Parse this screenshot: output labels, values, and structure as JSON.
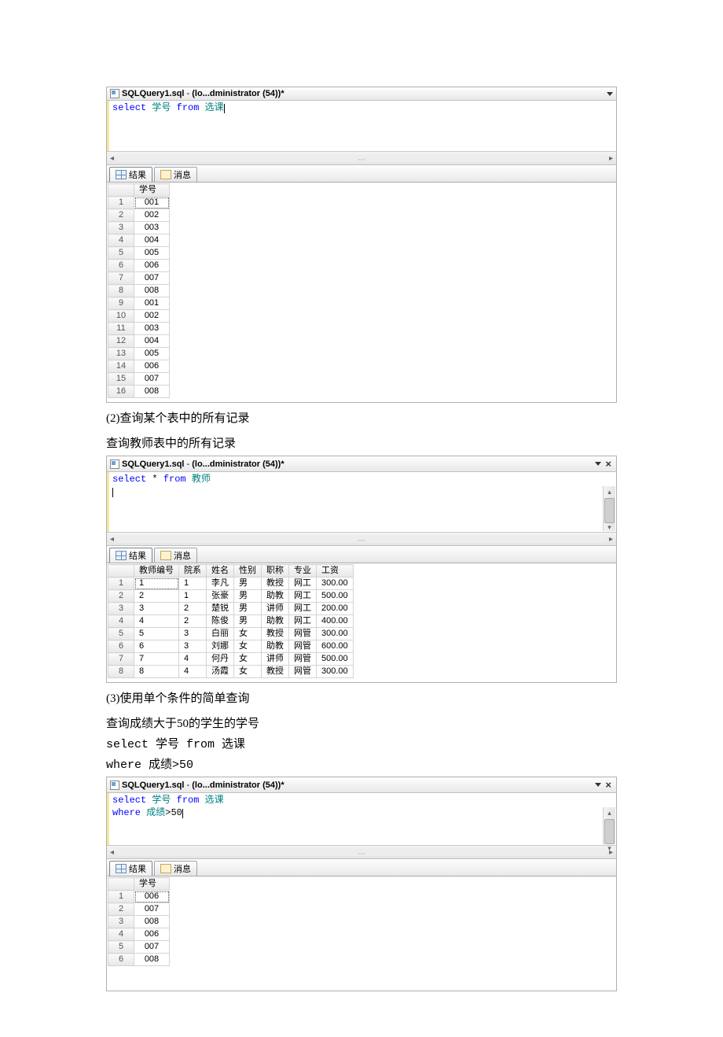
{
  "panel1": {
    "title_prefix": "SQLQuery1.sql",
    "title_sep": " - ",
    "title_suffix": "(lo...dministrator (54))*",
    "sql_tokens": [
      "select",
      " ",
      "学号",
      " ",
      "from",
      " ",
      "选课"
    ],
    "tabs": {
      "results": "结果",
      "messages": "消息"
    },
    "columns": [
      "学号"
    ],
    "rows": [
      [
        "001"
      ],
      [
        "002"
      ],
      [
        "003"
      ],
      [
        "004"
      ],
      [
        "005"
      ],
      [
        "006"
      ],
      [
        "007"
      ],
      [
        "008"
      ],
      [
        "001"
      ],
      [
        "002"
      ],
      [
        "003"
      ],
      [
        "004"
      ],
      [
        "005"
      ],
      [
        "006"
      ],
      [
        "007"
      ],
      [
        "008"
      ]
    ]
  },
  "text1": "(2)查询某个表中的所有记录",
  "text2": "查询教师表中的所有记录",
  "panel2": {
    "title_prefix": "SQLQuery1.sql",
    "title_sep": " - ",
    "title_suffix": "(lo...dministrator (54))*",
    "sql_tokens": [
      "select",
      " ",
      "*",
      " ",
      "from",
      " ",
      "教师"
    ],
    "tabs": {
      "results": "结果",
      "messages": "消息"
    },
    "columns": [
      "教师编号",
      "院系",
      "姓名",
      "性别",
      "职称",
      "专业",
      "工资"
    ],
    "rows": [
      [
        "1",
        "1",
        "李凡",
        "男",
        "教授",
        "网工",
        "300.00"
      ],
      [
        "2",
        "1",
        "张豪",
        "男",
        "助教",
        "网工",
        "500.00"
      ],
      [
        "3",
        "2",
        "楚锐",
        "男",
        "讲师",
        "网工",
        "200.00"
      ],
      [
        "4",
        "2",
        "陈俊",
        "男",
        "助教",
        "网工",
        "400.00"
      ],
      [
        "5",
        "3",
        "白丽",
        "女",
        "教授",
        "网管",
        "300.00"
      ],
      [
        "6",
        "3",
        "刘娜",
        "女",
        "助教",
        "网管",
        "600.00"
      ],
      [
        "7",
        "4",
        "何丹",
        "女",
        "讲师",
        "网管",
        "500.00"
      ],
      [
        "8",
        "4",
        "汤霞",
        "女",
        "教授",
        "网管",
        "300.00"
      ]
    ]
  },
  "text3": "(3)使用单个条件的简单查询",
  "text4": "查询成绩大于50的学生的学号",
  "code1": "select 学号 from 选课",
  "code2": "where 成绩>50",
  "panel3": {
    "title_prefix": "SQLQuery1.sql",
    "title_sep": " - ",
    "title_suffix": "(lo...dministrator (54))*",
    "sql_line1_tokens": [
      "select",
      " ",
      "学号",
      " ",
      "from",
      " ",
      "选课"
    ],
    "sql_line2_tokens": [
      "where",
      " ",
      "成绩",
      ">",
      "50"
    ],
    "tabs": {
      "results": "结果",
      "messages": "消息"
    },
    "columns": [
      "学号"
    ],
    "rows": [
      [
        "006"
      ],
      [
        "007"
      ],
      [
        "008"
      ],
      [
        "006"
      ],
      [
        "007"
      ],
      [
        "008"
      ]
    ]
  }
}
